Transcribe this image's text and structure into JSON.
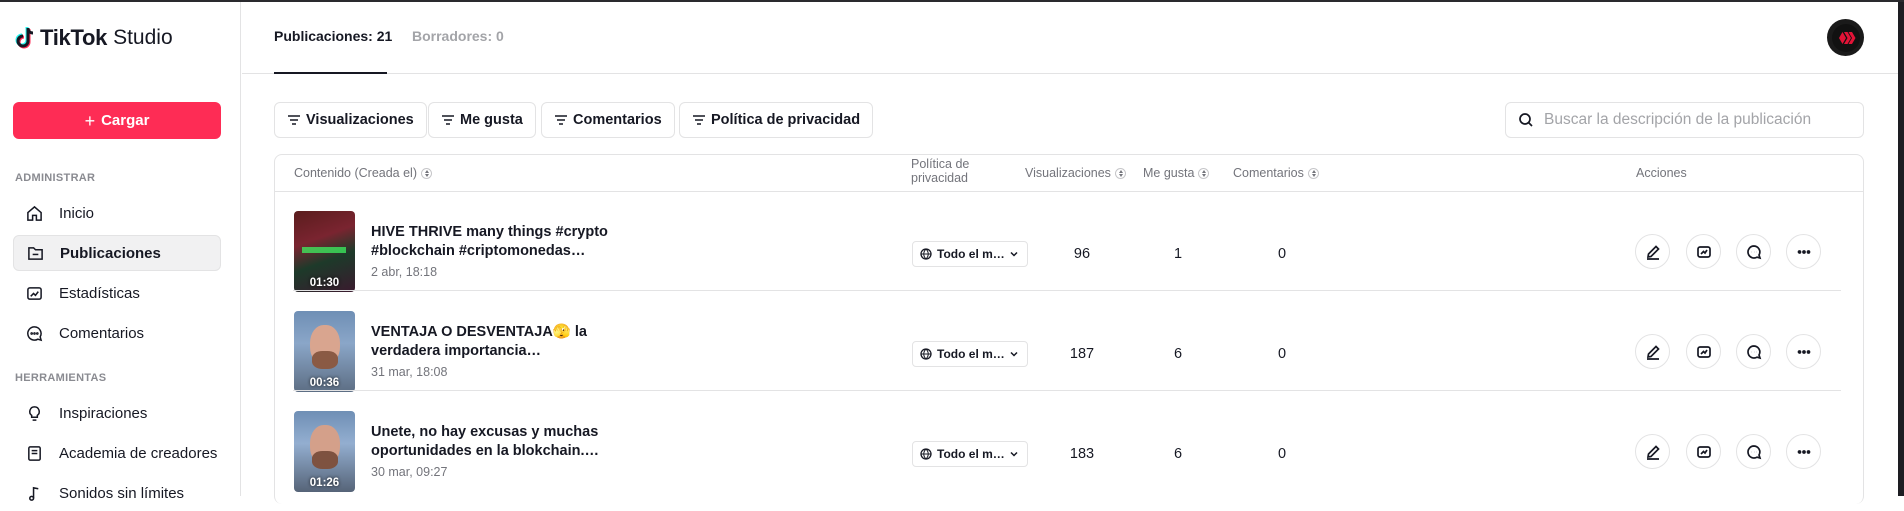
{
  "sidebar": {
    "logo_text": "TikTok",
    "logo_studio": "Studio",
    "upload_label": "Cargar",
    "section_admin": "ADMINISTRAR",
    "section_tools": "HERRAMIENTAS",
    "items": [
      {
        "label": "Inicio",
        "icon": "home-icon"
      },
      {
        "label": "Publicaciones",
        "icon": "posts-icon"
      },
      {
        "label": "Estadísticas",
        "icon": "analytics-icon"
      },
      {
        "label": "Comentarios",
        "icon": "comments-icon"
      },
      {
        "label": "Inspiraciones",
        "icon": "lightbulb-icon"
      },
      {
        "label": "Academia de creadores",
        "icon": "academy-icon"
      },
      {
        "label": "Sonidos sin límites",
        "icon": "music-note-icon"
      }
    ]
  },
  "header": {
    "tabs": [
      {
        "label": "Publicaciones: 21"
      },
      {
        "label": "Borradores: 0"
      }
    ]
  },
  "filters": [
    {
      "label": "Visualizaciones"
    },
    {
      "label": "Me gusta"
    },
    {
      "label": "Comentarios"
    },
    {
      "label": "Política de privacidad"
    }
  ],
  "search": {
    "placeholder": "Buscar la descripción de la publicación"
  },
  "table": {
    "columns": {
      "content": "Contenido (Creada el)",
      "privacy": "Política de privacidad",
      "views": "Visualizaciones",
      "likes": "Me gusta",
      "comments": "Comentarios",
      "actions": "Acciones"
    },
    "rows": [
      {
        "duration": "01:30",
        "description": "HIVE THRIVE many things #crypto #blockchain #criptomonedas…",
        "date": "2 abr, 18:18",
        "privacy": "Todo el m…",
        "views": "96",
        "likes": "1",
        "comments": "0"
      },
      {
        "duration": "00:36",
        "description": "VENTAJA O DESVENTAJA🫣 la verdadera importancia…",
        "date": "31 mar, 18:08",
        "privacy": "Todo el m…",
        "views": "187",
        "likes": "6",
        "comments": "0"
      },
      {
        "duration": "01:26",
        "description": "Unete, no hay excusas y muchas oportunidades en la blokchain.…",
        "date": "30 mar, 09:27",
        "privacy": "Todo el m…",
        "views": "183",
        "likes": "6",
        "comments": "0"
      }
    ]
  },
  "colors": {
    "brand": "#fe2c55",
    "text": "#161823",
    "muted": "#73747b"
  }
}
